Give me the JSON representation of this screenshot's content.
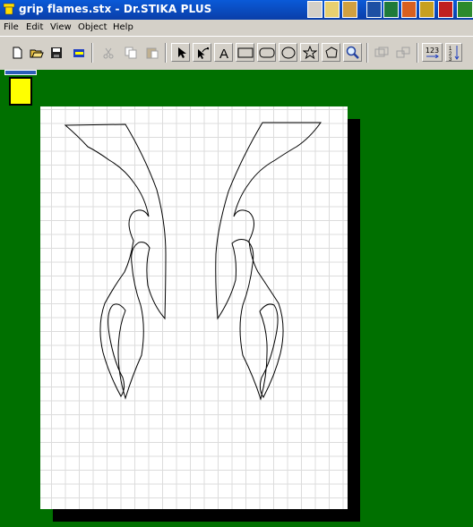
{
  "window": {
    "title": "grip flames.stx - Dr.STIKA PLUS"
  },
  "menu": {
    "items": [
      "File",
      "Edit",
      "View",
      "Object",
      "Help"
    ]
  },
  "toolbar": {
    "buttons": [
      "new-icon",
      "open-icon",
      "save-icon",
      "cutter-icon",
      "cut-icon",
      "copy-icon",
      "paste-icon",
      "select-icon",
      "node-edit-icon",
      "text-icon",
      "rectangle-icon",
      "rounded-rectangle-icon",
      "ellipse-icon",
      "star-icon",
      "polygon-icon",
      "zoom-icon",
      "group-icon",
      "ungroup-icon",
      "numbering-icon",
      "vertical-numbering-icon"
    ],
    "numbering_label": "123"
  },
  "colors": {
    "title_bar": "#0a4ed0",
    "workspace": "#007000",
    "palette_swatch": "#ffff00",
    "page": "#ffffff"
  }
}
